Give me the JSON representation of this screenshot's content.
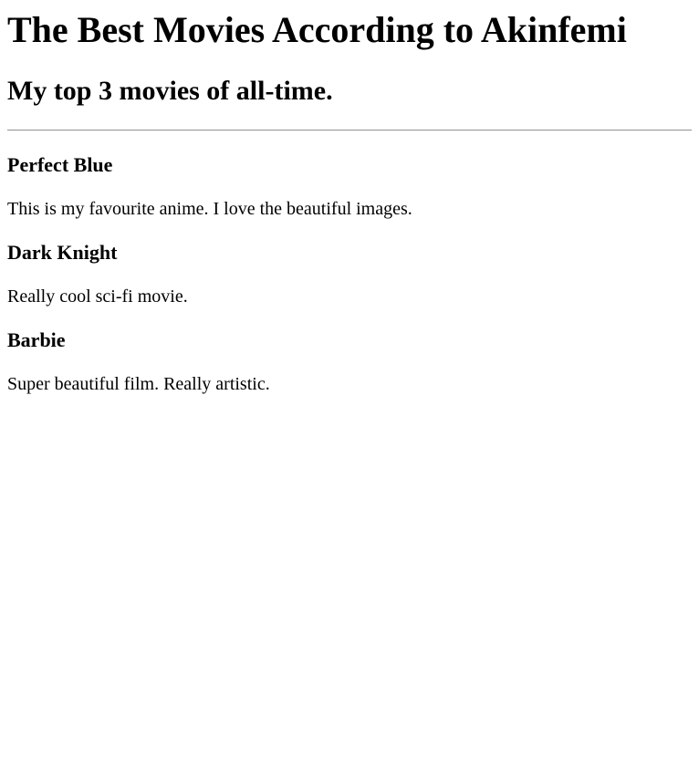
{
  "page": {
    "title": "The Best Movies According to Akinfemi",
    "subtitle": "My top 3 movies of all-time."
  },
  "movies": [
    {
      "title": "Perfect Blue",
      "description": "This is my favourite anime. I love the beautiful images."
    },
    {
      "title": "Dark Knight",
      "description": "Really cool sci-fi movie."
    },
    {
      "title": "Barbie",
      "description": "Super beautiful film. Really artistic."
    }
  ]
}
